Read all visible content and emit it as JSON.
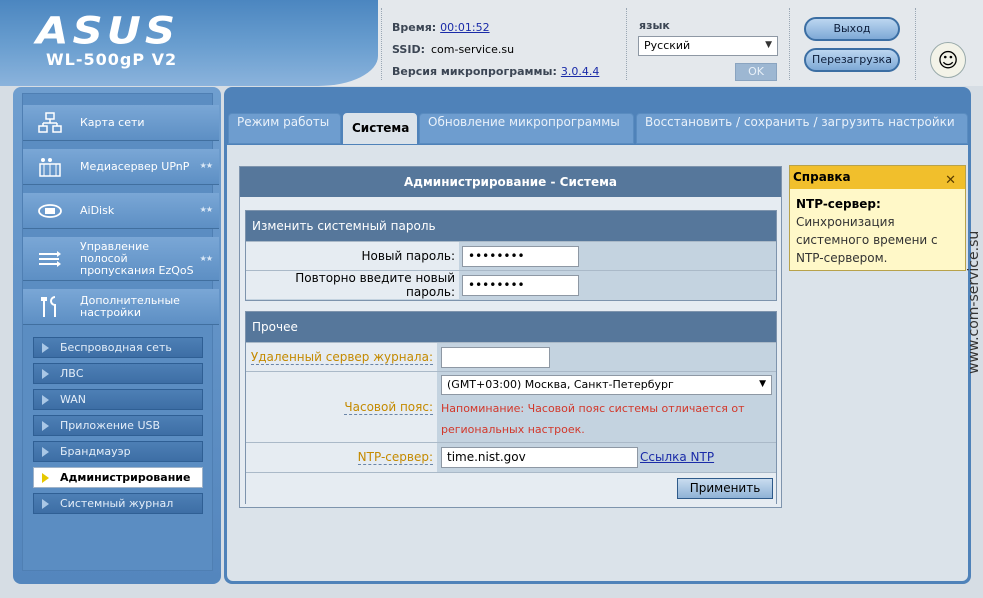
{
  "brand": {
    "logo": "ASUS",
    "model": "WL-500gP V2"
  },
  "status": {
    "time_label": "Время:",
    "time_value": "00:01:52",
    "ssid_label": "SSID:",
    "ssid_value": "com-service.su",
    "firmware_label": "Версия микропрограммы:",
    "firmware_value": "3.0.4.4"
  },
  "language": {
    "label": "язык",
    "selected": "Русский",
    "ok_label": "OK"
  },
  "header_buttons": {
    "logout": "Выход",
    "reboot": "Перезагрузка"
  },
  "sidebar": {
    "main_items": [
      {
        "label": "Карта сети",
        "icon": "network-map-icon"
      },
      {
        "label": "Медиасервер UPnP",
        "icon": "media-server-icon"
      },
      {
        "label": "AiDisk",
        "icon": "aidisk-icon"
      },
      {
        "label": "Управление полосой пропускания EzQoS",
        "icon": "ezqos-icon"
      },
      {
        "label": "Дополнительные настройки",
        "icon": "tools-icon"
      }
    ],
    "sub_items": [
      {
        "label": "Беспроводная сеть"
      },
      {
        "label": "ЛВС"
      },
      {
        "label": "WAN"
      },
      {
        "label": "Приложение USB"
      },
      {
        "label": "Брандмауэр"
      },
      {
        "label": "Администрирование"
      },
      {
        "label": "Системный журнал"
      }
    ],
    "active_sub_item": "Администрирование"
  },
  "tabs": [
    {
      "label": "Режим работы"
    },
    {
      "label": "Система"
    },
    {
      "label": "Обновление микропрограммы"
    },
    {
      "label": "Восстановить / сохранить / загрузить настройки"
    }
  ],
  "active_tab": "Система",
  "admin": {
    "title": "Администрирование - Система",
    "password_section": {
      "heading": "Изменить системный пароль",
      "new_password_label": "Новый пароль:",
      "new_password_value": "••••••••",
      "repeat_password_label": "Повторно введите новый пароль:",
      "repeat_password_value": "••••••••"
    },
    "other_section": {
      "heading": "Прочее",
      "remote_log_label": "Удаленный сервер журнала:",
      "remote_log_value": "",
      "timezone_label": "Часовой пояс:",
      "timezone_value": "(GMT+03:00) Москва, Санкт-Петербург",
      "timezone_warning": "Напоминание: Часовой пояс системы отличается от региональных настроек.",
      "ntp_label": "NTP-сервер:",
      "ntp_value": "time.nist.gov",
      "ntp_link": "Ссылка NTP",
      "apply_label": "Применить"
    }
  },
  "help": {
    "title": "Справка",
    "close": "✕",
    "term": "NTP-сервер:",
    "text": "Синхронизация системного времени с NTP-сервером."
  },
  "watermark": "www.com-service.su",
  "colors": {
    "accent_blue": "#4f82b9",
    "title_bar": "#56779b",
    "warning_red": "#d2382b",
    "help_header": "#f1bf2c"
  }
}
